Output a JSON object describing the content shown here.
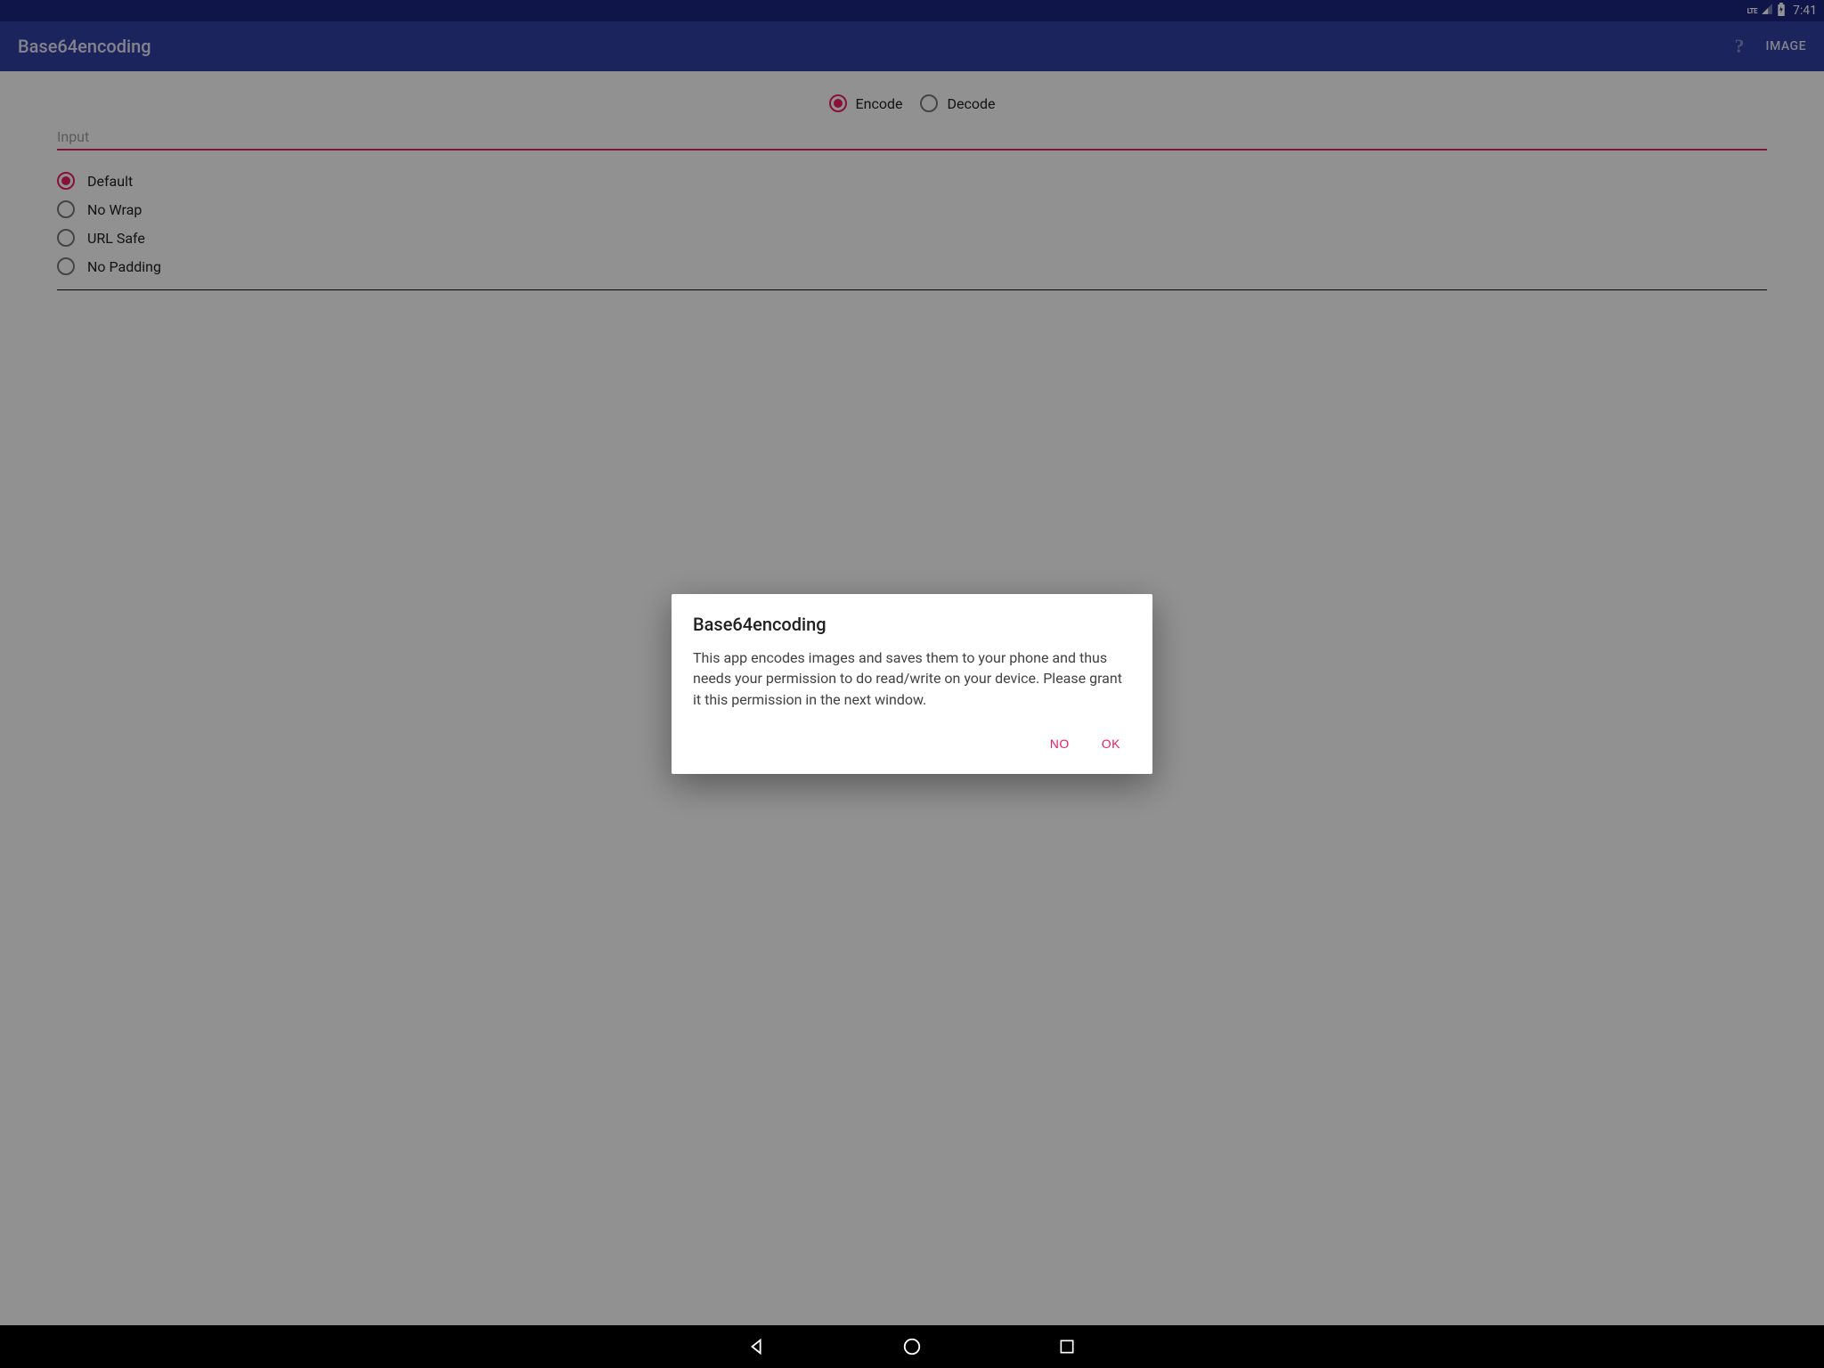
{
  "status": {
    "network": "LTE",
    "time": "7:41"
  },
  "appbar": {
    "title": "Base64encoding",
    "help": "?",
    "action": "IMAGE"
  },
  "mode": {
    "encode": "Encode",
    "decode": "Decode",
    "selected": "encode"
  },
  "input": {
    "placeholder": "Input",
    "value": ""
  },
  "options": [
    {
      "label": "Default",
      "checked": true
    },
    {
      "label": "No Wrap",
      "checked": false
    },
    {
      "label": "URL Safe",
      "checked": false
    },
    {
      "label": "No Padding",
      "checked": false
    }
  ],
  "dialog": {
    "title": "Base64encoding",
    "body": "This app encodes images and saves them to your phone and thus needs your permission to do read/write on your device. Please grant it this permission in the next window.",
    "no": "NO",
    "ok": "OK"
  },
  "colors": {
    "primary": "#303f9f",
    "primaryDark": "#1a237e",
    "accent": "#e91e63"
  }
}
